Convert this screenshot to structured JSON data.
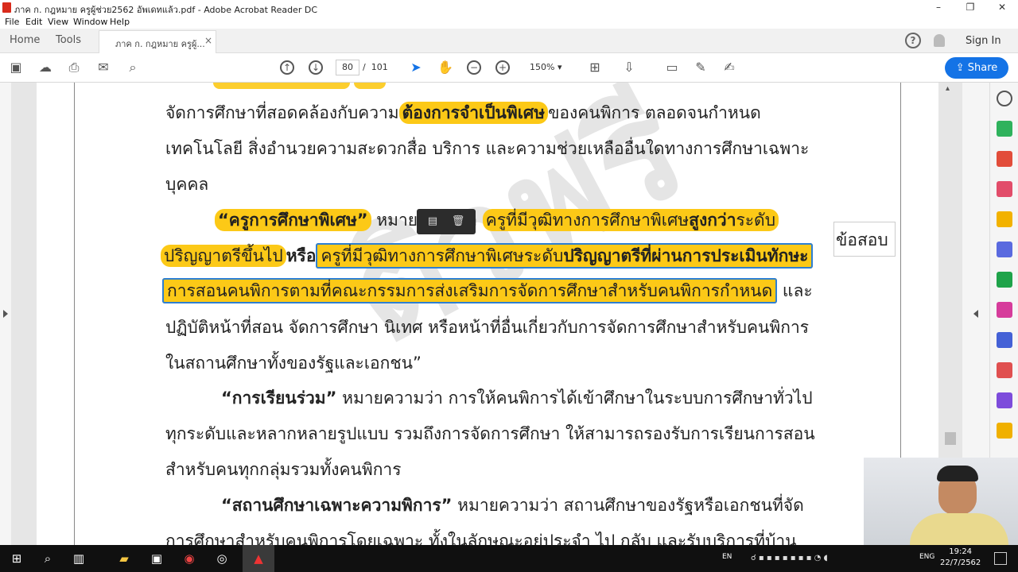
{
  "window": {
    "title": "ภาค ก. กฎหมาย ครูผู้ช่วย2562 อัพเดทแล้ว.pdf - Adobe Acrobat Reader DC",
    "minimize": "–",
    "maximize": "❐",
    "close": "✕"
  },
  "menu": {
    "file": "File",
    "edit": "Edit",
    "view": "View",
    "window": "Window",
    "help": "Help"
  },
  "tabs": {
    "home": "Home",
    "tools": "Tools",
    "document": "ภาค ก. กฎหมาย ครูผู้...",
    "close": "×",
    "sign_in": "Sign In",
    "help_glyph": "?"
  },
  "toolbar": {
    "current_page": "80",
    "page_separator": "/",
    "total_pages": "101",
    "zoom": "150%",
    "share": "Share"
  },
  "document": {
    "lines": {
      "l1_a": "จัดการศึกษาที่สอดคล้องกับความ",
      "l1_b": "ต้องการจำเป็นพิเศษ",
      "l1_c": "ของคนพิการ ตลอดจนกำหนด",
      "l2": "เทคโนโลยี สิ่งอำนวยความสะดวกสื่อ บริการ และความช่วยเหลืออื่นใดทางการศึกษาเฉพาะ",
      "l3": "บุคคล",
      "l4_a": "“ครูการศึกษาพิเศษ”",
      "l4_b": " หมายความว่า ",
      "l4_c": "ครูที่มีวุฒิทางการศึกษาพิเศษ",
      "l4_d": "สูงกว่า",
      "l4_e": "ระดับ",
      "l5_a": "ปริญญาตรีขึ้นไป",
      "l5_b": "หรือ",
      "l5_c": "ครูที่มีวุฒิทางการศึกษาพิเศษระดับ",
      "l5_d": "ปริญญาตรีที่ผ่านการประเมินทักษะ",
      "l6_a": "การสอนคนพิการตามที่คณะกรรมการส่งเสริมการจัดการศึกษาสำหรับคนพิการกำหนด",
      "l6_b": " และ",
      "l7": "ปฏิบัติหน้าที่สอน จัดการศึกษา นิเทศ หรือหน้าที่อื่นเกี่ยวกับการจัดการศึกษาสำหรับคนพิการ",
      "l8": "ในสถานศึกษาทั้งของรัฐและเอกชน”",
      "l9_a": "“การเรียนร่วม”",
      "l9_b": " หมายความว่า การให้คนพิการได้เข้าศึกษาในระบบการศึกษาทั่วไป",
      "l10": "ทุกระดับและหลากหลายรูปแบบ รวมถึงการจัดการศึกษา ให้สามารถรองรับการเรียนการสอน",
      "l11": "สำหรับคนทุกกลุ่มรวมทั้งคนพิการ",
      "l12_a": "“สถานศึกษาเฉพาะความพิการ”",
      "l12_b": " หมายความว่า สถานศึกษาของรัฐหรือเอกชนที่จัด",
      "l13": "การศึกษาสำหรับคนพิการโดยเฉพาะ ทั้งในลักษณะอยู่ประจำ ไป กลับ และรับบริการที่บ้าน"
    },
    "sticky_note": "ข้อสอบ"
  },
  "taskbar": {
    "lang_left": "EN",
    "lang_right": "ENG",
    "time": "19:24",
    "date": "22/7/2562"
  }
}
